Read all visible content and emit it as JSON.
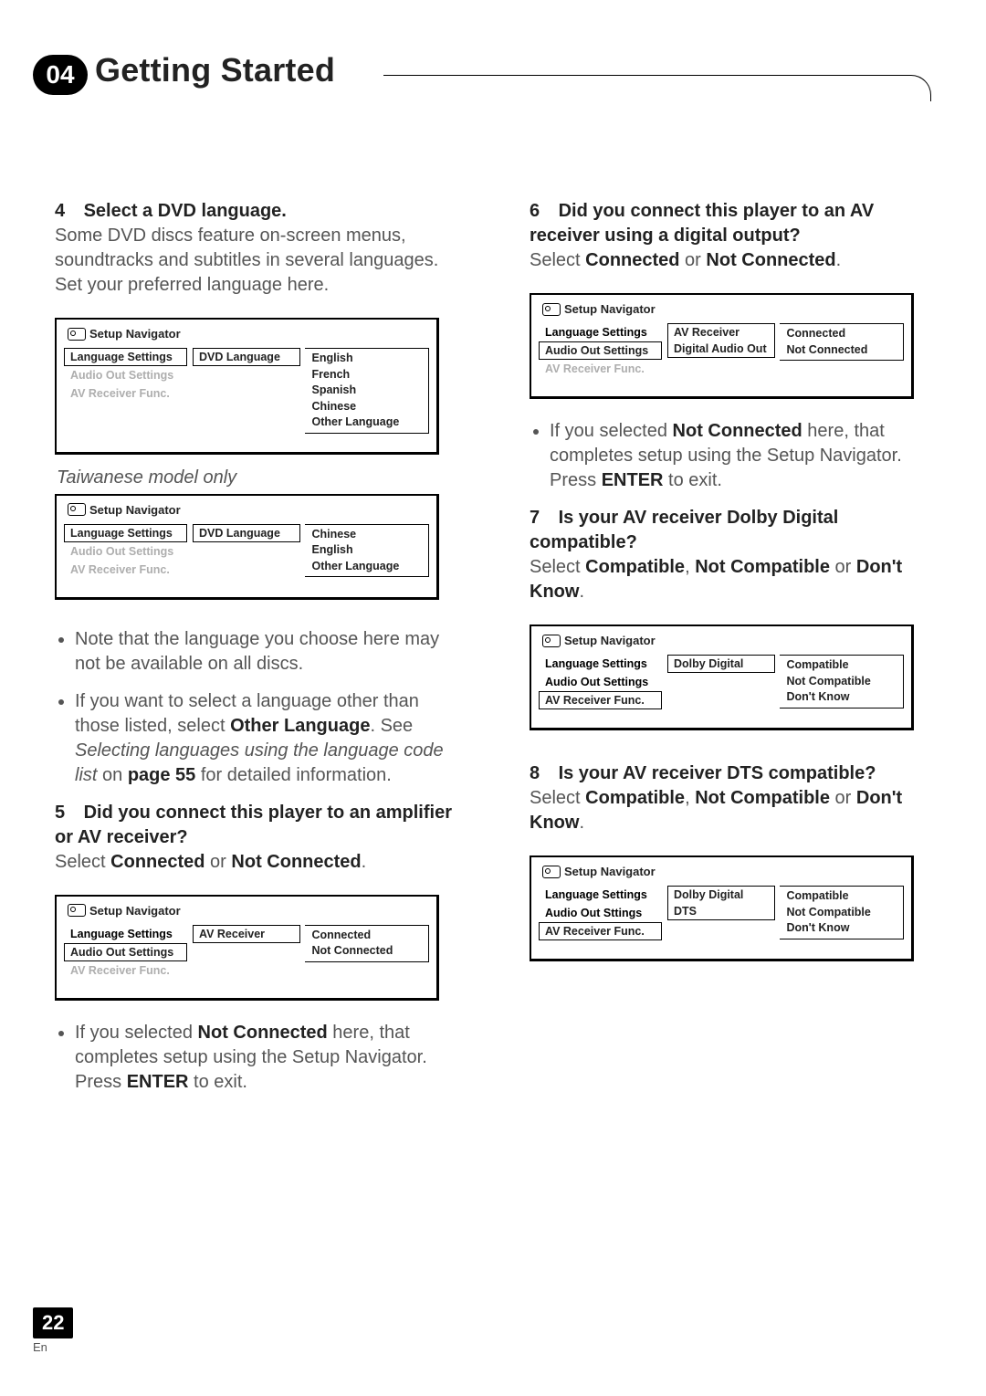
{
  "header": {
    "chapter_num": "04",
    "chapter_title": "Getting Started"
  },
  "left": {
    "step4": {
      "num": "4",
      "title": "Select a DVD language.",
      "body": "Some DVD discs feature on-screen menus, soundtracks and subtitles in several languages. Set your preferred language here."
    },
    "box4a": {
      "title": "Setup Navigator",
      "cats": [
        "Language Settings",
        "Audio Out Settings",
        "AV Receiver Func."
      ],
      "sel": "DVD Language",
      "opts": [
        "English",
        "French",
        "Spanish",
        "Chinese",
        "Other Language"
      ]
    },
    "taiwan_note": "Taiwanese model only",
    "box4b": {
      "title": "Setup Navigator",
      "cats": [
        "Language Settings",
        "Audio Out Settings",
        "AV Receiver Func."
      ],
      "sel": "DVD Language",
      "opts": [
        "Chinese",
        "English",
        "Other Language"
      ]
    },
    "bullets4": {
      "b1": "Note that the language you choose here may not be available on all discs.",
      "b2_pre": "If you want to select a language other than those listed, select ",
      "b2_bold1": "Other Language",
      "b2_mid1": ". See ",
      "b2_ital": "Selecting languages using the language code list",
      "b2_mid2": " on ",
      "b2_bold2": "page 55",
      "b2_post": " for detailed information."
    },
    "step5": {
      "num": "5",
      "title": "Did you connect this player to an amplifier or AV receiver?",
      "instr_pre": "Select ",
      "instr_b1": "Connected",
      "instr_mid": " or ",
      "instr_b2": "Not Connected",
      "instr_post": "."
    },
    "box5": {
      "title": "Setup Navigator",
      "cats": [
        "Language Settings",
        "Audio Out Settings",
        "AV Receiver Func."
      ],
      "sel": "AV Receiver",
      "opts": [
        "Connected",
        "Not Connected"
      ]
    },
    "bullets5": {
      "pre": "If you selected ",
      "b1": "Not Connected",
      "mid": " here, that completes setup using the Setup Navigator. Press ",
      "b2": "ENTER",
      "post": " to exit."
    }
  },
  "right": {
    "step6": {
      "num": "6",
      "title": "Did you connect this player to an AV receiver using a digital output?",
      "instr_pre": "Select ",
      "instr_b1": "Connected",
      "instr_mid": " or ",
      "instr_b2": "Not Connected",
      "instr_post": "."
    },
    "box6": {
      "title": "Setup Navigator",
      "cats": [
        "Language Settings",
        "Audio Out Settings",
        "AV Receiver Func."
      ],
      "sel1": "AV Receiver",
      "sel2": "Digital Audio Out",
      "opts": [
        "Connected",
        "Not Connected"
      ]
    },
    "bullets6": {
      "pre": "If you selected ",
      "b1": "Not Connected",
      "mid": " here, that completes setup using the Setup Navigator. Press ",
      "b2": "ENTER",
      "post": " to exit."
    },
    "step7": {
      "num": "7",
      "title": "Is your AV receiver Dolby Digital compatible?",
      "instr_pre": "Select ",
      "instr_b1": "Compatible",
      "instr_mid1": ", ",
      "instr_b2": "Not Compatible",
      "instr_mid2": " or ",
      "instr_b3": "Don't Know",
      "instr_post": "."
    },
    "box7": {
      "title": "Setup Navigator",
      "cats": [
        "Language Settings",
        "Audio Out Settings",
        "AV Receiver Func."
      ],
      "sel": "Dolby Digital",
      "opts": [
        "Compatible",
        "Not Compatible",
        "Don't Know"
      ]
    },
    "step8": {
      "num": "8",
      "title": "Is your AV receiver DTS compatible?",
      "instr_pre": "Select ",
      "instr_b1": "Compatible",
      "instr_mid1": ", ",
      "instr_b2": "Not Compatible",
      "instr_mid2": " or ",
      "instr_b3": "Don't Know",
      "instr_post": "."
    },
    "box8": {
      "title": "Setup Navigator",
      "cats": [
        "Language Settings",
        "Audio Out Sttings",
        "AV Receiver Func."
      ],
      "sel1": "Dolby Digital",
      "sel2": "DTS",
      "opts": [
        "Compatible",
        "Not Compatible",
        "Don't Know"
      ]
    }
  },
  "footer": {
    "page_num": "22",
    "lang": "En"
  }
}
